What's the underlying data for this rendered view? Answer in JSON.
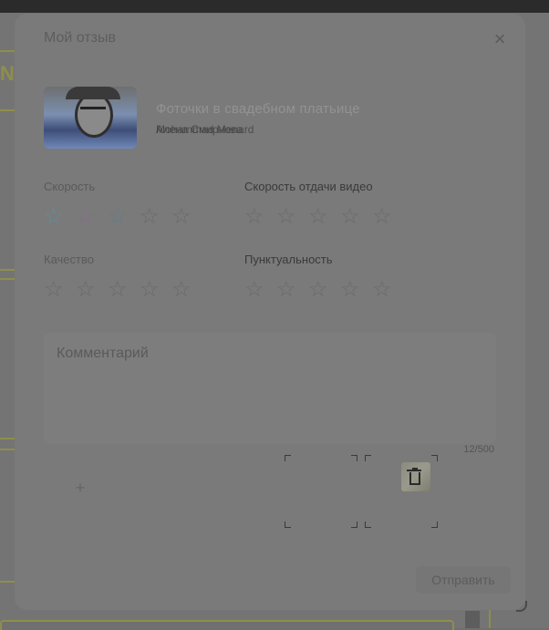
{
  "modal": {
    "title": "Мой отзыв",
    "close_label": "×"
  },
  "order": {
    "title": "Фоточки в свадебном платьице",
    "subtitle_a": "Алена Смирнова",
    "subtitle_b": "Mohammad Menard"
  },
  "ratings": [
    {
      "label": "Скорость",
      "value": 3,
      "max": 5
    },
    {
      "label": "Скорость отдачи видео",
      "value": 0,
      "max": 5
    },
    {
      "label": "Качество",
      "value": 0,
      "max": 5
    },
    {
      "label": "Пунктуальность",
      "value": 0,
      "max": 5
    }
  ],
  "comment": {
    "placeholder": "Комментарий",
    "char_count": "12/500"
  },
  "upload": {
    "add_icon": "plus-icon",
    "delete_icon": "trash-icon"
  },
  "actions": {
    "submit_label": "Отправить"
  },
  "background": {
    "left_letter": "N"
  },
  "colors": {
    "accent_olive": "#8f8e4a"
  }
}
